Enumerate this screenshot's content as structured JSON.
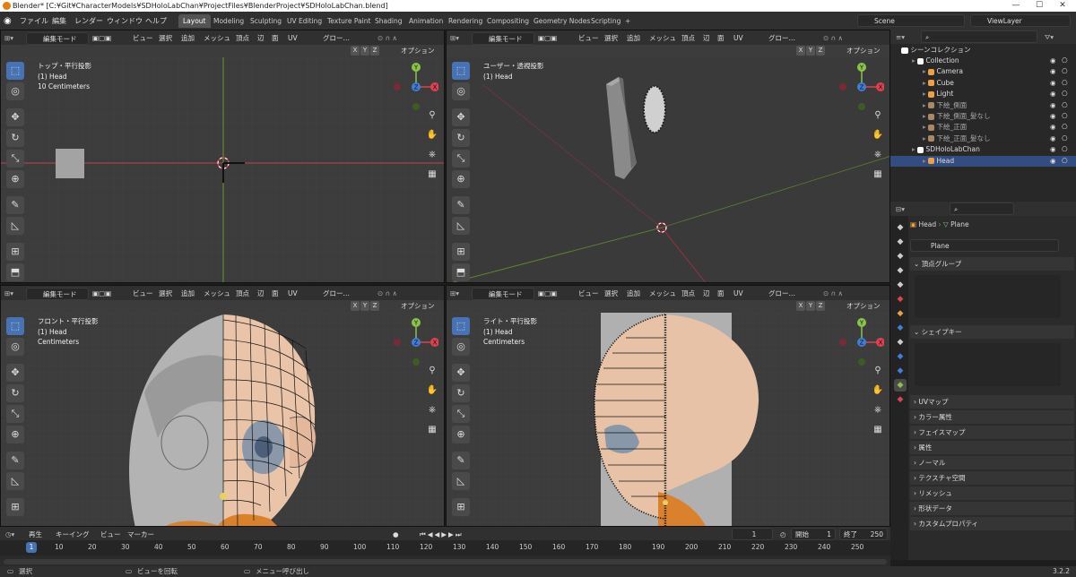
{
  "window": {
    "title": "Blender* [C:¥Git¥CharacterModels¥SDHoloLabChan¥ProjectFiles¥BlenderProject¥SDHoloLabChan.blend]",
    "minimize": "—",
    "maximize": "☐",
    "close": "✕"
  },
  "menu": [
    "ファイル",
    "編集",
    "レンダー",
    "ウィンドウ",
    "ヘルプ"
  ],
  "workspaces": [
    "Layout",
    "Modeling",
    "Sculpting",
    "UV Editing",
    "Texture Paint",
    "Shading",
    "Animation",
    "Rendering",
    "Compositing",
    "Geometry Nodes",
    "Scripting",
    "+"
  ],
  "scene": "Scene",
  "viewlayer": "ViewLayer",
  "viewport_header": {
    "mode": "編集モード",
    "menus": [
      "ビュー",
      "選択",
      "追加",
      "メッシュ",
      "頂点",
      "辺",
      "面",
      "UV"
    ],
    "transform": "グロー…",
    "x": "X",
    "y": "Y",
    "z": "Z",
    "options": "オプション"
  },
  "viewports": [
    {
      "view": "トップ・平行投影",
      "object": "(1) Head",
      "scale": "10 Centimeters"
    },
    {
      "view": "ユーザー・透視投影",
      "object": "(1) Head",
      "scale": ""
    },
    {
      "view": "フロント・平行投影",
      "object": "(1) Head",
      "scale": "Centimeters"
    },
    {
      "view": "ライト・平行投影",
      "object": "(1) Head",
      "scale": "Centimeters"
    }
  ],
  "gizmo": {
    "x": "X",
    "y": "Y",
    "z": "Z"
  },
  "outliner": {
    "root": "シーンコレクション",
    "items": [
      {
        "name": "Collection",
        "depth": 1
      },
      {
        "name": "Camera",
        "depth": 2
      },
      {
        "name": "Cube",
        "depth": 2
      },
      {
        "name": "Light",
        "depth": 2
      },
      {
        "name": "下絵_側面",
        "depth": 2
      },
      {
        "name": "下絵_側面_髪なし",
        "depth": 2
      },
      {
        "name": "下絵_正面",
        "depth": 2
      },
      {
        "name": "下絵_正面_髪なし",
        "depth": 2
      },
      {
        "name": "SDHoloLabChan",
        "depth": 1
      },
      {
        "name": "Head",
        "depth": 2
      }
    ]
  },
  "properties": {
    "breadcrumb_obj": "Head",
    "breadcrumb_mesh": "Plane",
    "mesh_name": "Plane",
    "panels_open": [
      "頂点グループ",
      "シェイプキー"
    ],
    "panels": [
      "UVマップ",
      "カラー属性",
      "フェイスマップ",
      "属性",
      "ノーマル",
      "テクスチャ空間",
      "リメッシュ",
      "形状データ",
      "カスタムプロパティ"
    ]
  },
  "timeline": {
    "menus": [
      "再生",
      "キーイング",
      "ビュー",
      "マーカー"
    ],
    "current": "1",
    "start_label": "開始",
    "start": "1",
    "end_label": "終了",
    "end": "250",
    "ticks": [
      "1",
      "10",
      "20",
      "30",
      "40",
      "50",
      "60",
      "70",
      "80",
      "90",
      "100",
      "110",
      "120",
      "130",
      "140",
      "150",
      "160",
      "170",
      "180",
      "190",
      "200",
      "210",
      "220",
      "230",
      "240",
      "250"
    ]
  },
  "status": {
    "select": "選択",
    "rotate": "ビューを回転",
    "menu": "メニュー呼び出し",
    "version": "3.2.2"
  },
  "colors": {
    "accent": "#4772b3",
    "x_axis": "#e04050",
    "y_axis": "#8bc34a",
    "z_axis": "#3f7fd8",
    "skin": "#e8c2a6",
    "viewport_bg": "#3c3c3c"
  }
}
